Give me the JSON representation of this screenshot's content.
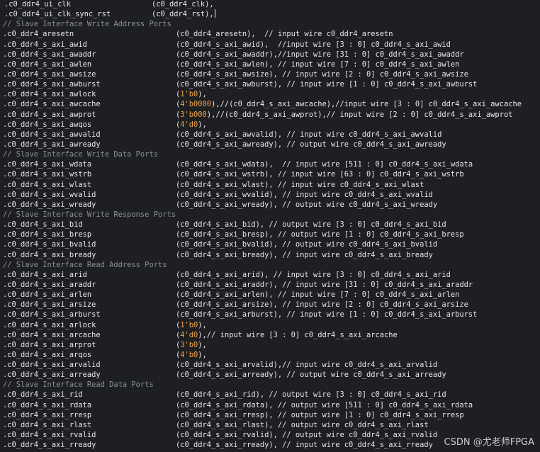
{
  "watermark": "CSDN @尤老师FPGA",
  "lines": [
    {
      "kind": "top",
      "port": ".c0_ddr4_ui_clk",
      "conn": "(c0_ddr4_clk),"
    },
    {
      "kind": "top",
      "port": ".c0_ddr4_ui_clk_sync_rst",
      "conn": "(c0_ddr4_rst),",
      "cursor": true
    },
    {
      "kind": "comment",
      "text": "// Slave Interface Write Address Ports"
    },
    {
      "kind": "port",
      "port": ".c0_ddr4_aresetn",
      "conn": "(c0_ddr4_aresetn),  // input wire c0_ddr4_aresetn"
    },
    {
      "kind": "port",
      "port": ".c0_ddr4_s_axi_awid",
      "conn": "(c0_ddr4_s_axi_awid),  //input wire [3 : 0] c0_ddr4_s_axi_awid"
    },
    {
      "kind": "port",
      "port": ".c0_ddr4_s_axi_awaddr",
      "conn": "(c0_ddr4_s_axi_awaddr),//input wire [31 : 0] c0_ddr4_s_axi_awaddr"
    },
    {
      "kind": "port",
      "port": ".c0_ddr4_s_axi_awlen",
      "conn": "(c0_ddr4_s_axi_awlen), // input wire [7 : 0] c0_ddr4_s_axi_awlen"
    },
    {
      "kind": "port",
      "port": ".c0_ddr4_s_axi_awsize",
      "conn": "(c0_ddr4_s_axi_awsize), // input wire [2 : 0] c0_ddr4_s_axi_awsize"
    },
    {
      "kind": "port",
      "port": ".c0_ddr4_s_axi_awburst",
      "conn": "(c0_ddr4_s_axi_awburst), // input wire [1 : 0] c0_ddr4_s_axi_awburst"
    },
    {
      "kind": "lit",
      "port": ".c0_ddr4_s_axi_awlock",
      "pre": "(",
      "lit": "1'b0",
      "post": "),"
    },
    {
      "kind": "lit",
      "port": ".c0_ddr4_s_axi_awcache",
      "pre": "(",
      "lit": "4'b0000",
      "post": "),//(c0_ddr4_s_axi_awcache),//input wire [3 : 0] c0_ddr4_s_axi_awcache"
    },
    {
      "kind": "lit",
      "port": ".c0_ddr4_s_axi_awprot",
      "pre": "(",
      "lit": "3'b000",
      "post": "),//(c0_ddr4_s_axi_awprot),// input wire [2 : 0] c0_ddr4_s_axi_awprot"
    },
    {
      "kind": "lit",
      "port": ".c0_ddr4_s_axi_awqos",
      "pre": "(",
      "lit": "4'd0",
      "post": "),"
    },
    {
      "kind": "port",
      "port": ".c0_ddr4_s_axi_awvalid",
      "conn": "(c0_ddr4_s_axi_awvalid), // input wire c0_ddr4_s_axi_awvalid"
    },
    {
      "kind": "port",
      "port": ".c0_ddr4_s_axi_awready",
      "conn": "(c0_ddr4_s_axi_awready), // output wire c0_ddr4_s_axi_awready"
    },
    {
      "kind": "comment",
      "text": "// Slave Interface Write Data Ports"
    },
    {
      "kind": "port",
      "port": ".c0_ddr4_s_axi_wdata",
      "conn": "(c0_ddr4_s_axi_wdata),  // input wire [511 : 0] c0_ddr4_s_axi_wdata"
    },
    {
      "kind": "port",
      "port": ".c0_ddr4_s_axi_wstrb",
      "conn": "(c0_ddr4_s_axi_wstrb), // input wire [63 : 0] c0_ddr4_s_axi_wstrb"
    },
    {
      "kind": "port",
      "port": ".c0_ddr4_s_axi_wlast",
      "conn": "(c0_ddr4_s_axi_wlast), // input wire c0_ddr4_s_axi_wlast"
    },
    {
      "kind": "port",
      "port": ".c0_ddr4_s_axi_wvalid",
      "conn": "(c0_ddr4_s_axi_wvalid), // input wire c0_ddr4_s_axi_wvalid"
    },
    {
      "kind": "port",
      "port": ".c0_ddr4_s_axi_wready",
      "conn": "(c0_ddr4_s_axi_wready), // output wire c0_ddr4_s_axi_wready"
    },
    {
      "kind": "comment",
      "text": "// Slave Interface Write Response Ports"
    },
    {
      "kind": "port",
      "port": ".c0_ddr4_s_axi_bid",
      "conn": "(c0_ddr4_s_axi_bid), // output wire [3 : 0] c0_ddr4_s_axi_bid"
    },
    {
      "kind": "port",
      "port": ".c0_ddr4_s_axi_bresp",
      "conn": "(c0_ddr4_s_axi_bresp), // output wire [1 : 0] c0_ddr4_s_axi_bresp"
    },
    {
      "kind": "port",
      "port": ".c0_ddr4_s_axi_bvalid",
      "conn": "(c0_ddr4_s_axi_bvalid), // output wire c0_ddr4_s_axi_bvalid"
    },
    {
      "kind": "port",
      "port": ".c0_ddr4_s_axi_bready",
      "conn": "(c0_ddr4_s_axi_bready), // input wire c0_ddr4_s_axi_bready"
    },
    {
      "kind": "comment",
      "text": "// Slave Interface Read Address Ports"
    },
    {
      "kind": "port",
      "port": ".c0_ddr4_s_axi_arid",
      "conn": "(c0_ddr4_s_axi_arid), // input wire [3 : 0] c0_ddr4_s_axi_arid"
    },
    {
      "kind": "port",
      "port": ".c0_ddr4_s_axi_araddr",
      "conn": "(c0_ddr4_s_axi_araddr), // input wire [31 : 0] c0_ddr4_s_axi_araddr"
    },
    {
      "kind": "port",
      "port": ".c0_ddr4_s_axi_arlen",
      "conn": "(c0_ddr4_s_axi_arlen), // input wire [7 : 0] c0_ddr4_s_axi_arlen"
    },
    {
      "kind": "port",
      "port": ".c0_ddr4_s_axi_arsize",
      "conn": "(c0_ddr4_s_axi_arsize), // input wire [2 : 0] c0_ddr4_s_axi_arsize"
    },
    {
      "kind": "port",
      "port": ".c0_ddr4_s_axi_arburst",
      "conn": "(c0_ddr4_s_axi_arburst), // input wire [1 : 0] c0_ddr4_s_axi_arburst"
    },
    {
      "kind": "lit",
      "port": ".c0_ddr4_s_axi_arlock",
      "pre": "(",
      "lit": "1'b0",
      "post": "),"
    },
    {
      "kind": "lit",
      "port": ".c0_ddr4_s_axi_arcache",
      "pre": "(",
      "lit": "4'd0",
      "post": "),// input wire [3 : 0] c0_ddr4_s_axi_arcache"
    },
    {
      "kind": "lit",
      "port": ".c0_ddr4_s_axi_arprot",
      "pre": "(",
      "lit": "3'b0",
      "post": "),"
    },
    {
      "kind": "lit",
      "port": ".c0_ddr4_s_axi_arqos",
      "pre": "(",
      "lit": "4'b0",
      "post": "),"
    },
    {
      "kind": "port",
      "port": ".c0_ddr4_s_axi_arvalid",
      "conn": "(c0_ddr4_s_axi_arvalid),// input wire c0_ddr4_s_axi_arvalid"
    },
    {
      "kind": "port",
      "port": ".c0_ddr4_s_axi_arready",
      "conn": "(c0_ddr4_s_axi_arready), // output wire c0_ddr4_s_axi_arready"
    },
    {
      "kind": "comment",
      "text": "// Slave Interface Read Data Ports"
    },
    {
      "kind": "port",
      "port": ".c0_ddr4_s_axi_rid",
      "conn": "(c0_ddr4_s_axi_rid), // output wire [3 : 0] c0_ddr4_s_axi_rid"
    },
    {
      "kind": "port",
      "port": ".c0_ddr4_s_axi_rdata",
      "conn": "(c0_ddr4_s_axi_rdata), // output wire [511 : 0] c0_ddr4_s_axi_rdata"
    },
    {
      "kind": "port",
      "port": ".c0_ddr4_s_axi_rresp",
      "conn": "(c0_ddr4_s_axi_rresp), // output wire [1 : 0] c0_ddr4_s_axi_rresp"
    },
    {
      "kind": "port",
      "port": ".c0_ddr4_s_axi_rlast",
      "conn": "(c0_ddr4_s_axi_rlast), // output wire c0_ddr4_s_axi_rlast"
    },
    {
      "kind": "port",
      "port": ".c0_ddr4_s_axi_rvalid",
      "conn": "(c0_ddr4_s_axi_rvalid), // output wire c0_ddr4_s_axi_rvalid"
    },
    {
      "kind": "port",
      "port": ".c0_ddr4_s_axi_rready",
      "conn": "(c0_ddr4_s_axi_rready), // input wire c0_ddr4_s_axi_rready"
    }
  ]
}
